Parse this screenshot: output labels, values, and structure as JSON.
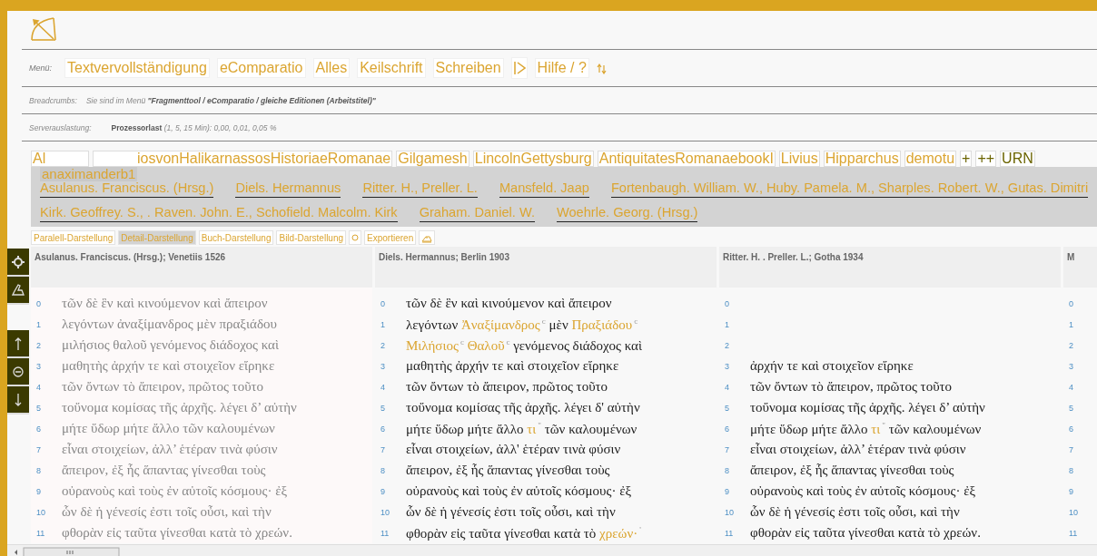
{
  "menu": {
    "label": "Menü:",
    "items": [
      {
        "kind": "text",
        "label": "Textvervollständigung"
      },
      {
        "kind": "text",
        "label": "eComparatio"
      },
      {
        "kind": "text",
        "label": "Alles"
      },
      {
        "kind": "text",
        "label": "Keilschrift"
      },
      {
        "kind": "text",
        "label": "Schreiben"
      },
      {
        "kind": "play-icon"
      },
      {
        "kind": "text",
        "label": "Hilfe / ?"
      },
      {
        "kind": "updown-icon"
      }
    ]
  },
  "breadcrumbs": {
    "label": "Breadcrumbs:",
    "text": "Sie sind im Menü **\"Fragmenttool / eComparatio / gleiche Editionen (Arbeitstitel)\"**"
  },
  "server_load": {
    "label": "Serverauslastung:",
    "text": "**Prozessorlast** *(1, 5, 15 Min): 0,00, 0,01, 0,05 %*"
  },
  "text_tabs": [
    {
      "label": "Al",
      "kind": "text",
      "selected": false
    },
    {
      "label": "iosvonHalikarnassosHistoriaeRomanae",
      "kind": "text",
      "selected": false
    },
    {
      "label": "Gilgamesh",
      "kind": "text",
      "selected": false
    },
    {
      "label": "LincolnGettysburg",
      "kind": "text",
      "selected": false
    },
    {
      "label": "AntiquitatesRomanaebookI",
      "kind": "text",
      "selected": false
    },
    {
      "label": "Livius",
      "kind": "text",
      "selected": false
    },
    {
      "label": "Hipparchus",
      "kind": "text",
      "selected": false
    },
    {
      "label": "demotu",
      "kind": "text",
      "selected": false
    },
    {
      "label": "+",
      "kind": "action",
      "selected": false
    },
    {
      "label": "++",
      "kind": "action",
      "selected": false
    },
    {
      "label": "URN",
      "kind": "action",
      "selected": false
    }
  ],
  "tooltip": "anaximanderb1",
  "editions": [
    "Asulanus. Franciscus. (Hrsg.)",
    "Diels. Hermannus",
    "Ritter. H., Preller. L.",
    "Mansfeld. Jaap",
    "Fortenbaugh. William. W., Huby. Pamela. M., Sharples. Robert. W., Gutas. Dimitri",
    "Kirk. Geoffrey. S., . Raven. John. E., Schofield. Malcolm. Kirk",
    "Graham. Daniel. W.",
    "Woehrle. Georg. (Hrsg.)"
  ],
  "view_buttons": [
    {
      "kind": "text",
      "label": "Paralell-Darstellung",
      "selected": false
    },
    {
      "kind": "text",
      "label": "Detail-Darstellung",
      "selected": true
    },
    {
      "kind": "text",
      "label": "Buch-Darstellung",
      "selected": false
    },
    {
      "kind": "text",
      "label": "Bild-Darstellung",
      "selected": false
    },
    {
      "kind": "circle-icon",
      "selected": false
    },
    {
      "kind": "text",
      "label": "Exportieren",
      "selected": false
    },
    {
      "kind": "home-icon",
      "selected": false
    }
  ],
  "columns": [
    {
      "kind": "base",
      "header": "Asulanus. Franciscus. (Hrsg.); Venetiis 1526",
      "lines": [
        {
          "number": "0",
          "segments": [
            {
              "kind": "plain",
              "text": "τῶν δὲ ἓν καὶ κινούμενον καὶ ἄπειρον"
            }
          ]
        },
        {
          "number": "1",
          "segments": [
            {
              "kind": "plain",
              "text": "λεγόντων ἀναξίμανδρος μὲν πραξιάδου"
            }
          ]
        },
        {
          "number": "2",
          "segments": [
            {
              "kind": "plain",
              "text": "μιλήσιος θαλοῦ γενόμενος διάδοχος καὶ"
            }
          ]
        },
        {
          "number": "3",
          "segments": [
            {
              "kind": "plain",
              "text": "μαθητὴς ἀρχήν τε καὶ στοιχεῖον εἴρηκε"
            }
          ]
        },
        {
          "number": "4",
          "segments": [
            {
              "kind": "plain",
              "text": "τῶν ὄντων τὸ ἄπειρον, πρῶτος τοῦτο"
            }
          ]
        },
        {
          "number": "5",
          "segments": [
            {
              "kind": "plain",
              "text": "τοὔνομα κομίσας τῆς ἀρχῆς. λέγει δ’ αὐτὴν"
            }
          ]
        },
        {
          "number": "6",
          "segments": [
            {
              "kind": "plain",
              "text": "μήτε ὕδωρ μήτε ἄλλο τῶν καλουμένων"
            }
          ]
        },
        {
          "number": "7",
          "segments": [
            {
              "kind": "plain",
              "text": "εἶναι στοιχείων, ἀλλ’ ἑτέραν τινὰ φύσιν"
            }
          ]
        },
        {
          "number": "8",
          "segments": [
            {
              "kind": "plain",
              "text": "ἄπειρον, ἐξ ἧς ἅπαντας γίνεσθαι τοὺς"
            }
          ]
        },
        {
          "number": "9",
          "segments": [
            {
              "kind": "plain",
              "text": "οὐρανοὺς καὶ τοὺς ἐν αὐτοῖς κόσμους· ἐξ"
            }
          ]
        },
        {
          "number": "10",
          "segments": [
            {
              "kind": "plain",
              "text": "ὧν δὲ ἡ γένεσίς ἐστι τοῖς οὖσι, καὶ τὴν"
            }
          ]
        },
        {
          "number": "11",
          "segments": [
            {
              "kind": "plain",
              "text": "φθορὰν εἰς ταῦτα γίνεσθαι κατὰ τὸ χρεών."
            }
          ]
        }
      ]
    },
    {
      "kind": "edition",
      "header": "Diels. Hermannus; Berlin 1903",
      "lines": [
        {
          "number": "0",
          "segments": [
            {
              "kind": "plain",
              "text": "τῶν δὲ ἓν καὶ κινούμενον καὶ ἄπειρον"
            }
          ]
        },
        {
          "number": "1",
          "segments": [
            {
              "kind": "plain",
              "text": "λεγόντων "
            },
            {
              "kind": "variant",
              "text": "Ἀναξίμανδρος"
            },
            {
              "kind": "note",
              "text": "c"
            },
            {
              "kind": "plain",
              "text": " μὲν "
            },
            {
              "kind": "variant",
              "text": "Πραξιάδου"
            },
            {
              "kind": "note",
              "text": "c"
            }
          ]
        },
        {
          "number": "2",
          "segments": [
            {
              "kind": "variant",
              "text": "Μιλήσιος"
            },
            {
              "kind": "note",
              "text": "c"
            },
            {
              "kind": "variant",
              "text": " Θαλοῦ"
            },
            {
              "kind": "note",
              "text": "c"
            },
            {
              "kind": "plain",
              "text": " γενόμενος διάδοχος καὶ"
            }
          ]
        },
        {
          "number": "3",
          "segments": [
            {
              "kind": "plain",
              "text": "μαθητὴς ἀρχήν τε καὶ στοιχεῖον εἴρηκε"
            }
          ]
        },
        {
          "number": "4",
          "segments": [
            {
              "kind": "plain",
              "text": "τῶν ὄντων τὸ ἄπειρον, πρῶτος τοῦτο"
            }
          ]
        },
        {
          "number": "5",
          "segments": [
            {
              "kind": "plain",
              "text": "τοὔνομα κομίσας τῆς ἀρχῆς. λέγει δ' αὐτὴν"
            }
          ]
        },
        {
          "number": "6",
          "segments": [
            {
              "kind": "plain",
              "text": "μήτε ὕδωρ μήτε ἄλλο "
            },
            {
              "kind": "variant",
              "text": "τι"
            },
            {
              "kind": "note",
              "text": "\""
            },
            {
              "kind": "plain",
              "text": " τῶν καλουμένων"
            }
          ]
        },
        {
          "number": "7",
          "segments": [
            {
              "kind": "plain",
              "text": "εἶναι στοιχείων, ἀλλ' ἑτέραν τινὰ φύσιν"
            }
          ]
        },
        {
          "number": "8",
          "segments": [
            {
              "kind": "plain",
              "text": "ἄπειρον, ἐξ ἧς ἅπαντας γίνεσθαι τοὺς"
            }
          ]
        },
        {
          "number": "9",
          "segments": [
            {
              "kind": "plain",
              "text": "οὐρανοὺς καὶ τοὺς ἐν αὐτοῖς κόσμους· ἐξ"
            }
          ]
        },
        {
          "number": "10",
          "segments": [
            {
              "kind": "plain",
              "text": "ὧν δὲ ἡ γένεσίς ἐστι τοῖς οὖσι, καὶ τὴν"
            }
          ]
        },
        {
          "number": "11",
          "segments": [
            {
              "kind": "plain",
              "text": "φθορὰν εἰς ταῦτα γίνεσθαι κατὰ τὸ "
            },
            {
              "kind": "variant",
              "text": "χρεών·"
            },
            {
              "kind": "note",
              "text": "'"
            }
          ]
        }
      ]
    },
    {
      "kind": "edition",
      "header": "Ritter. H. . Preller. L.; Gotha 1934",
      "lines": [
        {
          "number": "0"
        },
        {
          "number": "1"
        },
        {
          "number": "2"
        },
        {
          "number": "3",
          "segments": [
            {
              "kind": "plain",
              "text": "ἀρχήν τε καὶ στοιχεῖον εἴρηκε"
            }
          ]
        },
        {
          "number": "4",
          "segments": [
            {
              "kind": "plain",
              "text": "τῶν ὄντων τὸ ἄπειρον, πρῶτος τοῦτο"
            }
          ]
        },
        {
          "number": "5",
          "segments": [
            {
              "kind": "plain",
              "text": "τοὔνομα κομίσας τῆς ἀρχῆς. λέγει δ’ αὐτὴν"
            }
          ]
        },
        {
          "number": "6",
          "segments": [
            {
              "kind": "plain",
              "text": "μήτε ὕδωρ μήτε ἄλλο "
            },
            {
              "kind": "variant",
              "text": "τι"
            },
            {
              "kind": "note",
              "text": "\""
            },
            {
              "kind": "plain",
              "text": " τῶν καλουμένων"
            }
          ]
        },
        {
          "number": "7",
          "segments": [
            {
              "kind": "plain",
              "text": "εἶναι στοιχείων, ἀλλ’ ἑτέραν τινὰ φύσιν"
            }
          ]
        },
        {
          "number": "8",
          "segments": [
            {
              "kind": "plain",
              "text": "ἄπειρον, ἐξ ἧς ἅπαντας γίνεσθαι τοὺς"
            }
          ]
        },
        {
          "number": "9",
          "segments": [
            {
              "kind": "plain",
              "text": "οὐρανοὺς καὶ τοὺς ἐν αὐτοῖς κόσμους· ἐξ"
            }
          ]
        },
        {
          "number": "10",
          "segments": [
            {
              "kind": "plain",
              "text": "ὧν δὲ ἡ γένεσίς ἐστι τοῖς οὖσι, καὶ τὴν"
            }
          ]
        },
        {
          "number": "11",
          "segments": [
            {
              "kind": "plain",
              "text": "φθορὰν εἰς ταῦτα γίνεσθαι κατὰ τὸ χρεών."
            }
          ]
        }
      ]
    },
    {
      "kind": "edition",
      "header": "M",
      "lines": [
        {
          "number": "0"
        },
        {
          "number": "1"
        },
        {
          "number": "2"
        },
        {
          "number": "3"
        },
        {
          "number": "4"
        },
        {
          "number": "5"
        },
        {
          "number": "6"
        },
        {
          "number": "7"
        },
        {
          "number": "8"
        },
        {
          "number": "9"
        },
        {
          "number": "10"
        },
        {
          "number": "11"
        }
      ]
    }
  ],
  "side_tools": [
    {
      "kind": "gear"
    },
    {
      "kind": "edit"
    },
    {
      "kind": "gap"
    },
    {
      "kind": "up"
    },
    {
      "kind": "minus"
    },
    {
      "kind": "down"
    }
  ]
}
